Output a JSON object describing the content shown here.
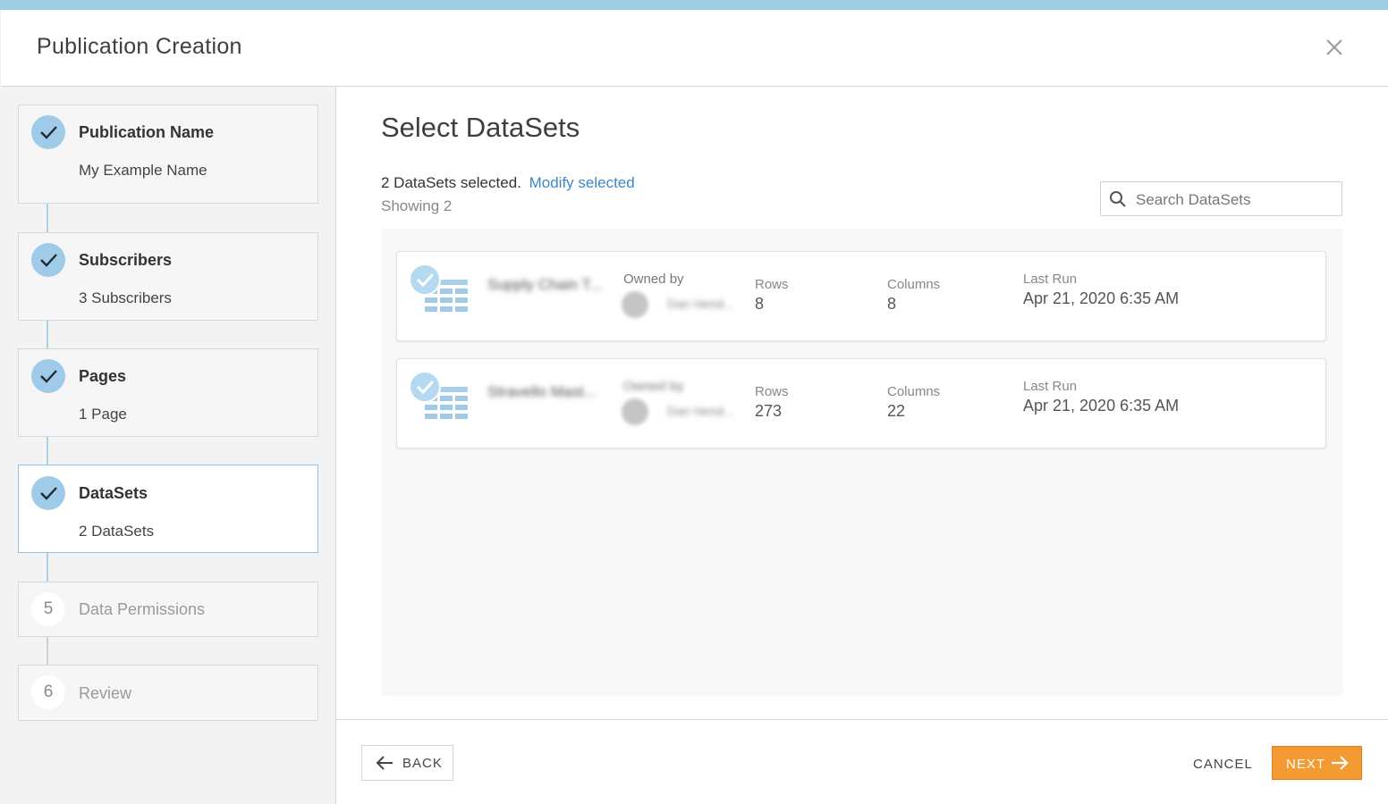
{
  "modal": {
    "title": "Publication Creation"
  },
  "steps": [
    {
      "number": "1",
      "title": "Publication Name",
      "subtitle": "My Example Name",
      "status": "complete"
    },
    {
      "number": "2",
      "title": "Subscribers",
      "subtitle": "3 Subscribers",
      "status": "complete"
    },
    {
      "number": "3",
      "title": "Pages",
      "subtitle": "1 Page",
      "status": "complete"
    },
    {
      "number": "4",
      "title": "DataSets",
      "subtitle": "2 DataSets",
      "status": "active"
    },
    {
      "number": "5",
      "title": "Data Permissions",
      "subtitle": "",
      "status": "pending"
    },
    {
      "number": "6",
      "title": "Review",
      "subtitle": "",
      "status": "pending"
    }
  ],
  "main": {
    "title": "Select DataSets",
    "selected_text": "2 DataSets selected.",
    "modify_link": "Modify selected",
    "showing_text": "Showing 2",
    "search_placeholder": "Search DataSets"
  },
  "datasets": [
    {
      "name": "Supply Chain T...",
      "owned_label": "Owned by",
      "owner": "Dan Hend...",
      "rows_label": "Rows",
      "rows": "8",
      "columns_label": "Columns",
      "columns": "8",
      "last_run_label": "Last Run",
      "last_run": "Apr 21, 2020 6:35 AM"
    },
    {
      "name": "Stravello Mast...",
      "owned_label": "Owned by",
      "owner": "Dan Hend...",
      "rows_label": "Rows",
      "rows": "273",
      "columns_label": "Columns",
      "columns": "22",
      "last_run_label": "Last Run",
      "last_run": "Apr 21, 2020 6:35 AM"
    }
  ],
  "footer": {
    "back_label": "BACK",
    "cancel_label": "CANCEL",
    "next_label": "NEXT"
  },
  "colors": {
    "accent_blue": "#9fcbe9",
    "link_blue": "#3e88c5",
    "next_orange": "#f49a33"
  }
}
